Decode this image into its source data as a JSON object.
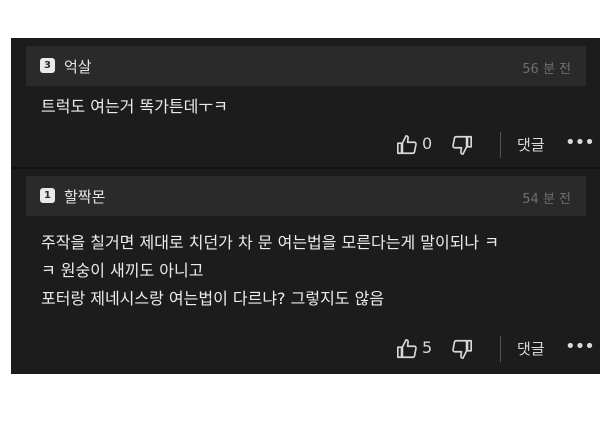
{
  "comments": [
    {
      "level": "3",
      "user": "억살",
      "time": "56 분 전",
      "lines": [
        "트럭도 여는거 똑가튼데ㅜㅋ"
      ],
      "likes": "0",
      "reply_label": "댓글",
      "more_label": "•••"
    },
    {
      "level": "1",
      "user": "할짝몬",
      "time": "54 분 전",
      "lines": [
        "주작을 칠거면 제대로 치던가 차 문 여는법을 모른다는게 말이되나 ㅋ",
        "ㅋ 원숭이 새끼도 아니고",
        "포터랑 제네시스랑 여는법이 다르냐? 그렇지도 않음"
      ],
      "likes": "5",
      "reply_label": "댓글",
      "more_label": "•••"
    }
  ]
}
